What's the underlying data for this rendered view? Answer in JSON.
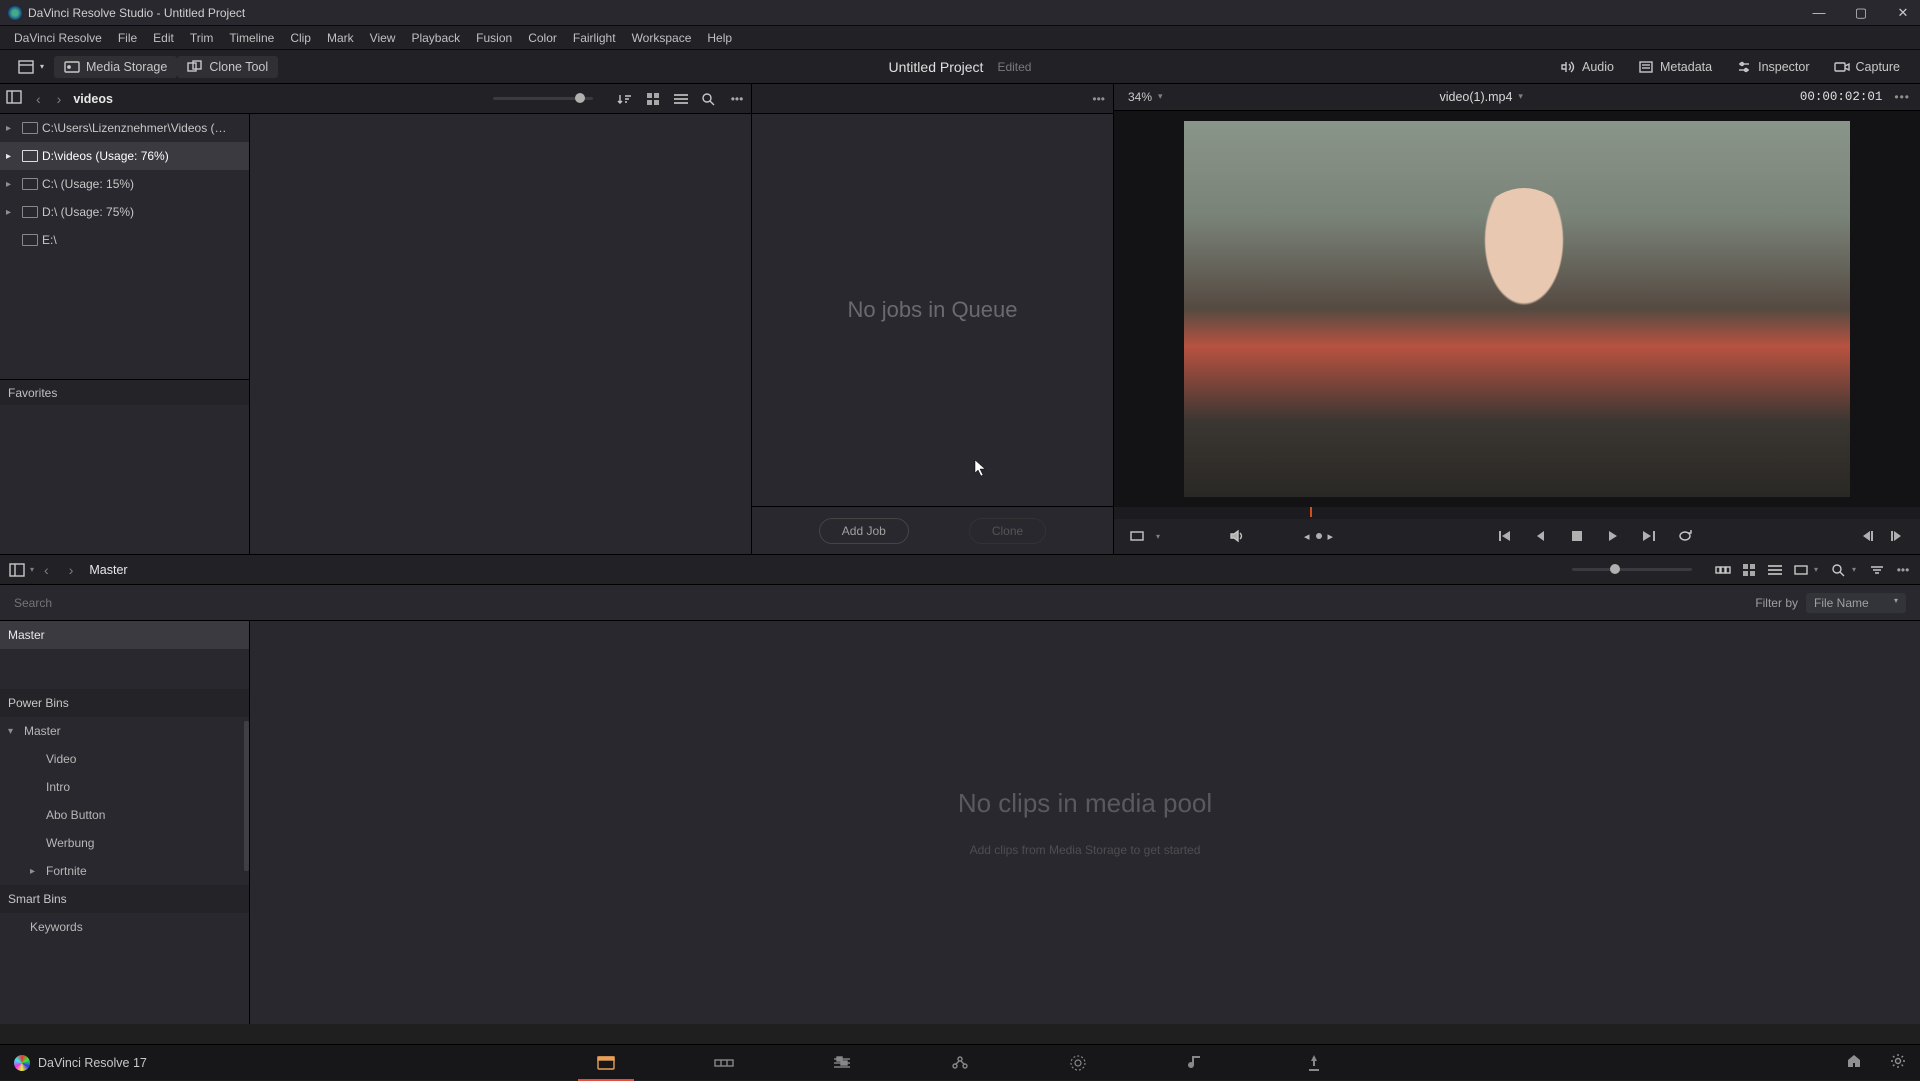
{
  "titlebar": {
    "text": "DaVinci Resolve Studio - Untitled Project"
  },
  "menubar": [
    "DaVinci Resolve",
    "File",
    "Edit",
    "Trim",
    "Timeline",
    "Clip",
    "Mark",
    "View",
    "Playback",
    "Fusion",
    "Color",
    "Fairlight",
    "Workspace",
    "Help"
  ],
  "toolbar": {
    "media_storage": "Media Storage",
    "clone_tool": "Clone Tool",
    "project_name": "Untitled Project",
    "project_status": "Edited",
    "audio": "Audio",
    "metadata": "Metadata",
    "inspector": "Inspector",
    "capture": "Capture"
  },
  "media_storage": {
    "breadcrumb": "videos",
    "tree": [
      {
        "label": "C:\\Users\\Lizenznehmer\\Videos (…",
        "selected": false
      },
      {
        "label": "D:\\videos (Usage: 76%)",
        "selected": true
      },
      {
        "label": "C:\\ (Usage: 15%)",
        "selected": false
      },
      {
        "label": "D:\\ (Usage: 75%)",
        "selected": false
      },
      {
        "label": "E:\\",
        "selected": false
      }
    ],
    "favorites_header": "Favorites"
  },
  "clone_tool": {
    "empty_message": "No jobs in Queue",
    "add_job": "Add Job",
    "clone": "Clone"
  },
  "viewer": {
    "zoom": "34%",
    "filename": "video(1).mp4",
    "timecode": "00:00:02:01"
  },
  "media_pool": {
    "breadcrumb": "Master",
    "search_placeholder": "Search",
    "filter_by_label": "Filter by",
    "filter_value": "File Name",
    "master_bin": "Master",
    "power_bins_header": "Power Bins",
    "power_bins": {
      "root": "Master",
      "children": [
        "Video",
        "Intro",
        "Abo Button",
        "Werbung",
        "Fortnite"
      ]
    },
    "smart_bins_header": "Smart Bins",
    "smart_bins": [
      "Keywords"
    ],
    "empty_big": "No clips in media pool",
    "empty_small": "Add clips from Media Storage to get started"
  },
  "pagebar": {
    "brand": "DaVinci Resolve 17"
  }
}
